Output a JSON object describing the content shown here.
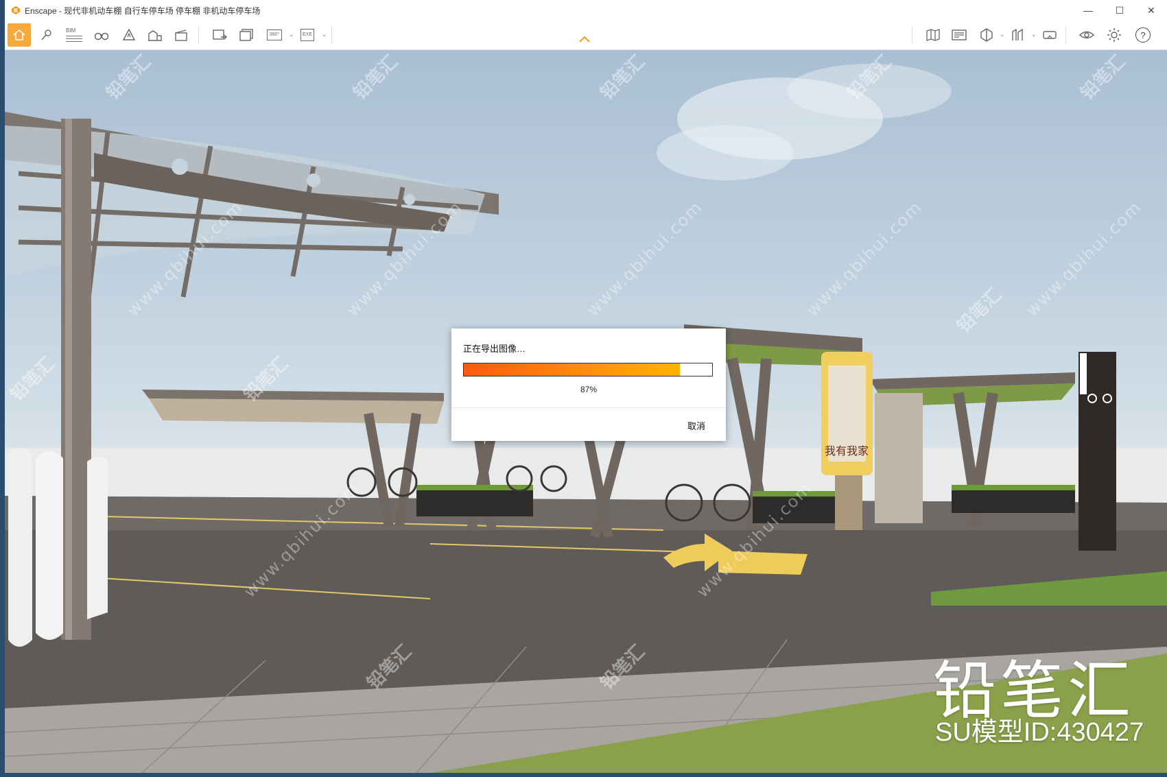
{
  "window": {
    "app_name": "Enscape",
    "document_title": "现代非机动车棚 自行车停车场 停车棚 非机动车停车场",
    "controls": {
      "minimize": "—",
      "maximize": "☐",
      "close": "✕"
    }
  },
  "toolbar": {
    "bim_label": "BIM",
    "view_360_label": "360°",
    "exe_label": "EXE",
    "help_label": "?",
    "icons": [
      "home-icon",
      "location-pin-icon",
      "bim-list-icon",
      "binoculars-icon",
      "asset-library-icon",
      "buildings-icon",
      "video-editor-icon",
      "export-image-icon",
      "batch-render-icon",
      "panorama-360-icon",
      "exe-export-icon",
      "map-icon",
      "web-standalone-icon",
      "cube-view-icon",
      "sections-icon",
      "vr-headset-icon",
      "visibility-eye-icon",
      "settings-gear-icon",
      "help-icon"
    ]
  },
  "dialog": {
    "title": "正在导出图像…",
    "progress_percent": 87,
    "progress_text": "87%",
    "cancel_label": "取消"
  },
  "scene": {
    "kiosk_poster_text": "我有我家",
    "watermark_brand": "铅笔汇",
    "watermark_model_id": "SU模型ID:430427",
    "watermark_url": "www.qbihui.com"
  },
  "colors": {
    "accent": "#f7a93c",
    "progress_start": "#ff5a10",
    "progress_end": "#ffb400"
  }
}
